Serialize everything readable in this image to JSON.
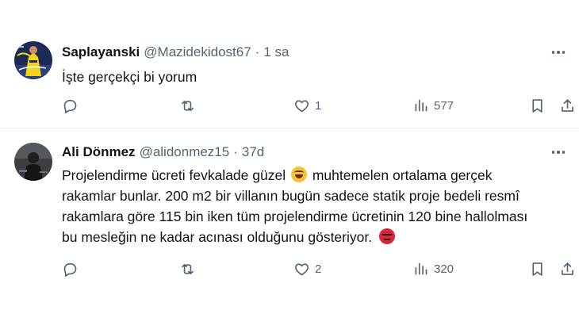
{
  "tweets": [
    {
      "name": "Saplayanski",
      "handle": "@Mazidekidost67",
      "separator": "·",
      "time": "1 sa",
      "text_lines": [
        "İşte gerçekçi bi yorum"
      ],
      "actions": {
        "replies": "",
        "retweets": "",
        "likes": "1",
        "views": "577"
      },
      "avatar": "yellow-blue sports-kit photo avatar"
    },
    {
      "name": "Ali Dönmez",
      "handle": "@alidonmez15",
      "separator": "·",
      "time": "37d",
      "text_lines": [
        "Projelendirme ücreti fevkalade güzel",
        "muhtemelen ortalama gerçek",
        "rakamlar bunlar. 200 m2 bir villanın bugün sadece statik proje bedeli resmî",
        "rakamlara göre 115 bin iken tüm projelendirme ücretinin 120 bine hallolması",
        "bu mesleğin ne kadar acınası olduğunu gösteriyor."
      ],
      "emojis": [
        "rolling-on-the-floor-laughing-emoji",
        "angry-face-emoji"
      ],
      "actions": {
        "replies": "",
        "retweets": "",
        "likes": "2",
        "views": "320"
      },
      "avatar": "dark photo avatar of a person"
    }
  ],
  "icons": [
    "reply-icon",
    "retweet-icon",
    "like-icon",
    "views-icon",
    "bookmark-icon",
    "share-icon",
    "more-icon"
  ],
  "colors": {
    "text": "#0f1419",
    "secondary": "#536471",
    "divider": "#eff3f4",
    "background": "#ffffff"
  }
}
